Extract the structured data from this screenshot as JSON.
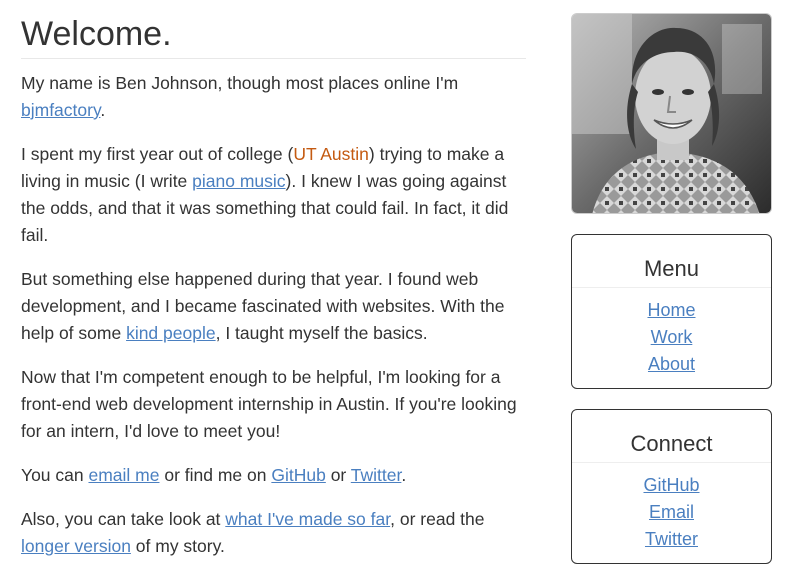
{
  "main": {
    "title": "Welcome.",
    "p1": {
      "t1": "My name is Ben Johnson, though most places online I'm ",
      "handle": "bjmfactory",
      "t2": "."
    },
    "p2": {
      "t1": "I spent my first year out of college (",
      "school": "UT Austin",
      "t2": ") trying to make a living in music (I write ",
      "link": "piano music",
      "t3": "). I knew I was going against the odds, and that it was something that could fail. In fact, it did fail."
    },
    "p3": {
      "t1": "But something else happened during that year. I found web development, and I became fascinated with websites. With the help of some ",
      "link": "kind people",
      "t2": ", I taught myself the basics."
    },
    "p4": {
      "text": "Now that I'm competent enough to be helpful, I'm looking for a front-end web development internship in Austin. If you're looking for an intern, I'd love to meet you!"
    },
    "p5": {
      "t1": "You can ",
      "email": "email me",
      "t2": " or find me on ",
      "github": "GitHub",
      "t3": " or ",
      "twitter": "Twitter",
      "t4": "."
    },
    "p6": {
      "t1": "Also, you can take look at ",
      "link1": "what I've made so far",
      "t2": ", or read the ",
      "link2": "longer version",
      "t3": " of my story."
    }
  },
  "sidebar": {
    "menu": {
      "title": "Menu",
      "items": [
        "Home",
        "Work",
        "About"
      ]
    },
    "connect": {
      "title": "Connect",
      "items": [
        "GitHub",
        "Email",
        "Twitter"
      ]
    }
  },
  "colors": {
    "link": "#4a7fc0",
    "school": "#c45a11",
    "text": "#333333"
  }
}
